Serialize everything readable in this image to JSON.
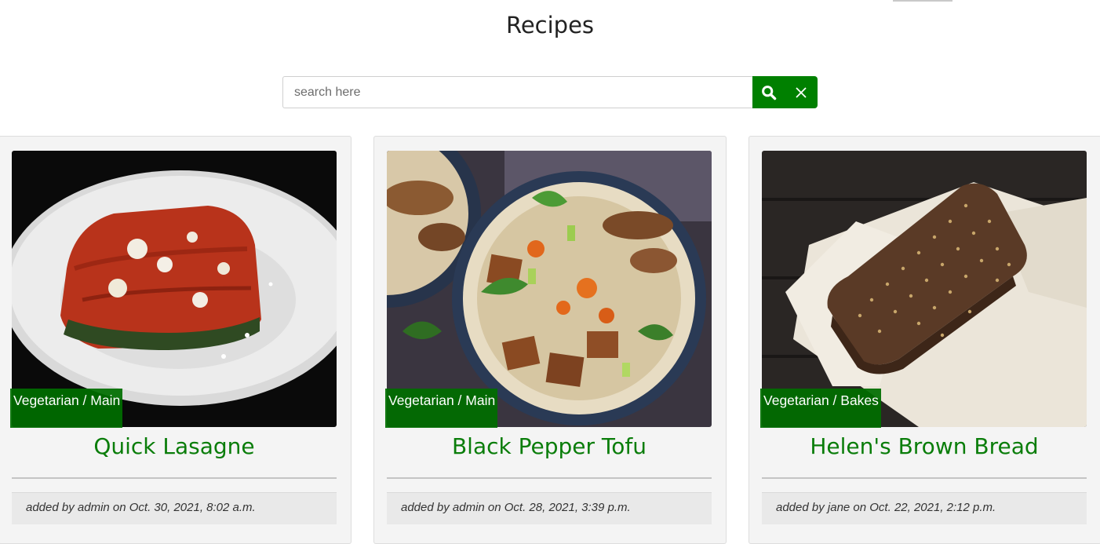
{
  "page": {
    "title": "Recipes"
  },
  "search": {
    "placeholder": "search here",
    "value": "",
    "search_icon": "search-icon",
    "clear_icon": "close-icon"
  },
  "colors": {
    "accent": "#008000",
    "title_green": "#0a7d0a",
    "badge_green": "#006e00"
  },
  "recipes": [
    {
      "category": "Vegetarian / Main",
      "title": "Quick Lasagne",
      "meta": "added by admin on Oct. 30, 2021, 8:02 a.m."
    },
    {
      "category": "Vegetarian / Main",
      "title": "Black Pepper Tofu",
      "meta": "added by admin on Oct. 28, 2021, 3:39 p.m."
    },
    {
      "category": "Vegetarian / Bakes",
      "title": "Helen's Brown Bread",
      "meta": "added by jane on Oct. 22, 2021, 2:12 p.m."
    }
  ]
}
